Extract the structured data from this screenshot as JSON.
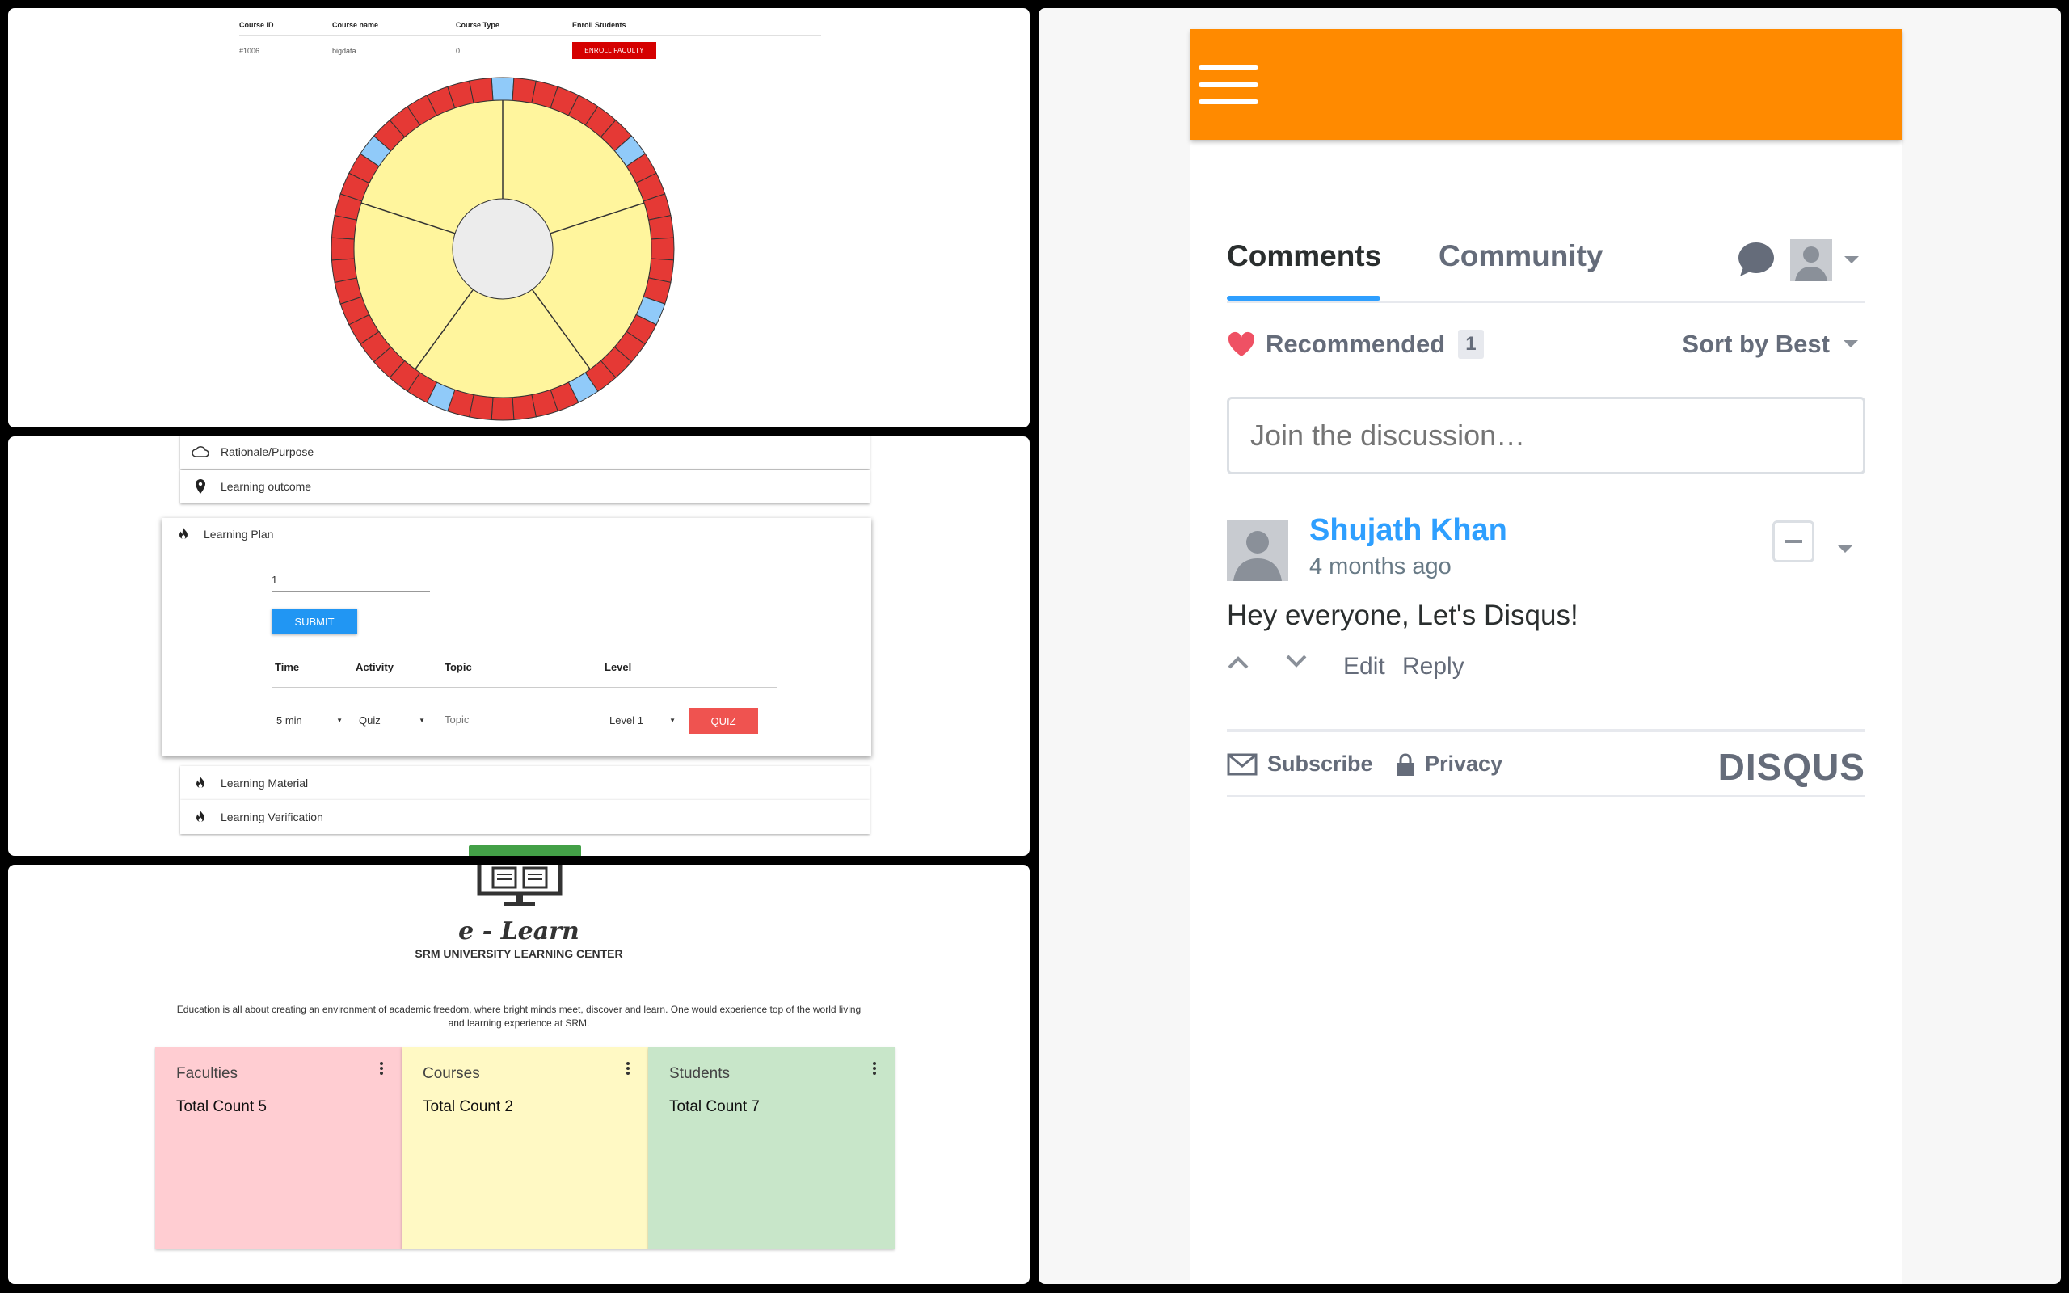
{
  "panel1": {
    "table": {
      "headers": [
        "Course ID",
        "Course name",
        "Course Type",
        "Enroll Students"
      ],
      "row": [
        "#1006",
        "bigdata",
        "0"
      ],
      "enroll_button": "ENROLL FACULTY"
    },
    "wheel": {
      "outer_segments": 48,
      "blue_segments": [
        0,
        7,
        15,
        20,
        27,
        41
      ],
      "colors": {
        "red": "#e53935",
        "blue": "#90caf9",
        "inner_fill": "#fff59d",
        "center": "#ececec"
      }
    }
  },
  "panel2": {
    "rows_top": [
      "Rationale/Purpose",
      "Learning outcome"
    ],
    "learning_plan": {
      "title": "Learning Plan",
      "input_value": "1",
      "submit_label": "SUBMIT",
      "headers": [
        "Time",
        "Activity",
        "Topic",
        "Level"
      ],
      "time_value": "5 min",
      "activity_value": "Quiz",
      "topic_placeholder": "Topic",
      "level_value": "Level 1",
      "quiz_label": "QUIZ"
    },
    "rows_bottom": [
      "Learning Material",
      "Learning Verification"
    ]
  },
  "panel3": {
    "logo_text": "e - Learn",
    "subtitle": "SRM UNIVERSITY LEARNING CENTER",
    "description_line1": "Education is all about creating an environment of academic freedom, where bright minds meet, discover and learn. One would experience top of the world living",
    "description_line2": "and learning experience at SRM.",
    "cards": [
      {
        "title": "Faculties",
        "count": "Total Count 5",
        "color": "#ffcdd2"
      },
      {
        "title": "Courses",
        "count": "Total Count 2",
        "color": "#fff9c4"
      },
      {
        "title": "Students",
        "count": "Total Count 7",
        "color": "#c8e6c9"
      }
    ]
  },
  "panel4": {
    "accent": "#ff8a00",
    "tabs": {
      "comments": "Comments",
      "community": "Community"
    },
    "recommended": "Recommended",
    "recommended_count": "1",
    "sort": "Sort by Best",
    "join_placeholder": "Join the discussion…",
    "comment": {
      "author": "Shujath Khan",
      "time": "4 months ago",
      "text": "Hey everyone, Let's Disqus!",
      "edit": "Edit",
      "reply": "Reply"
    },
    "footer": {
      "subscribe": "Subscribe",
      "privacy": "Privacy",
      "brand": "DISQUS"
    }
  }
}
